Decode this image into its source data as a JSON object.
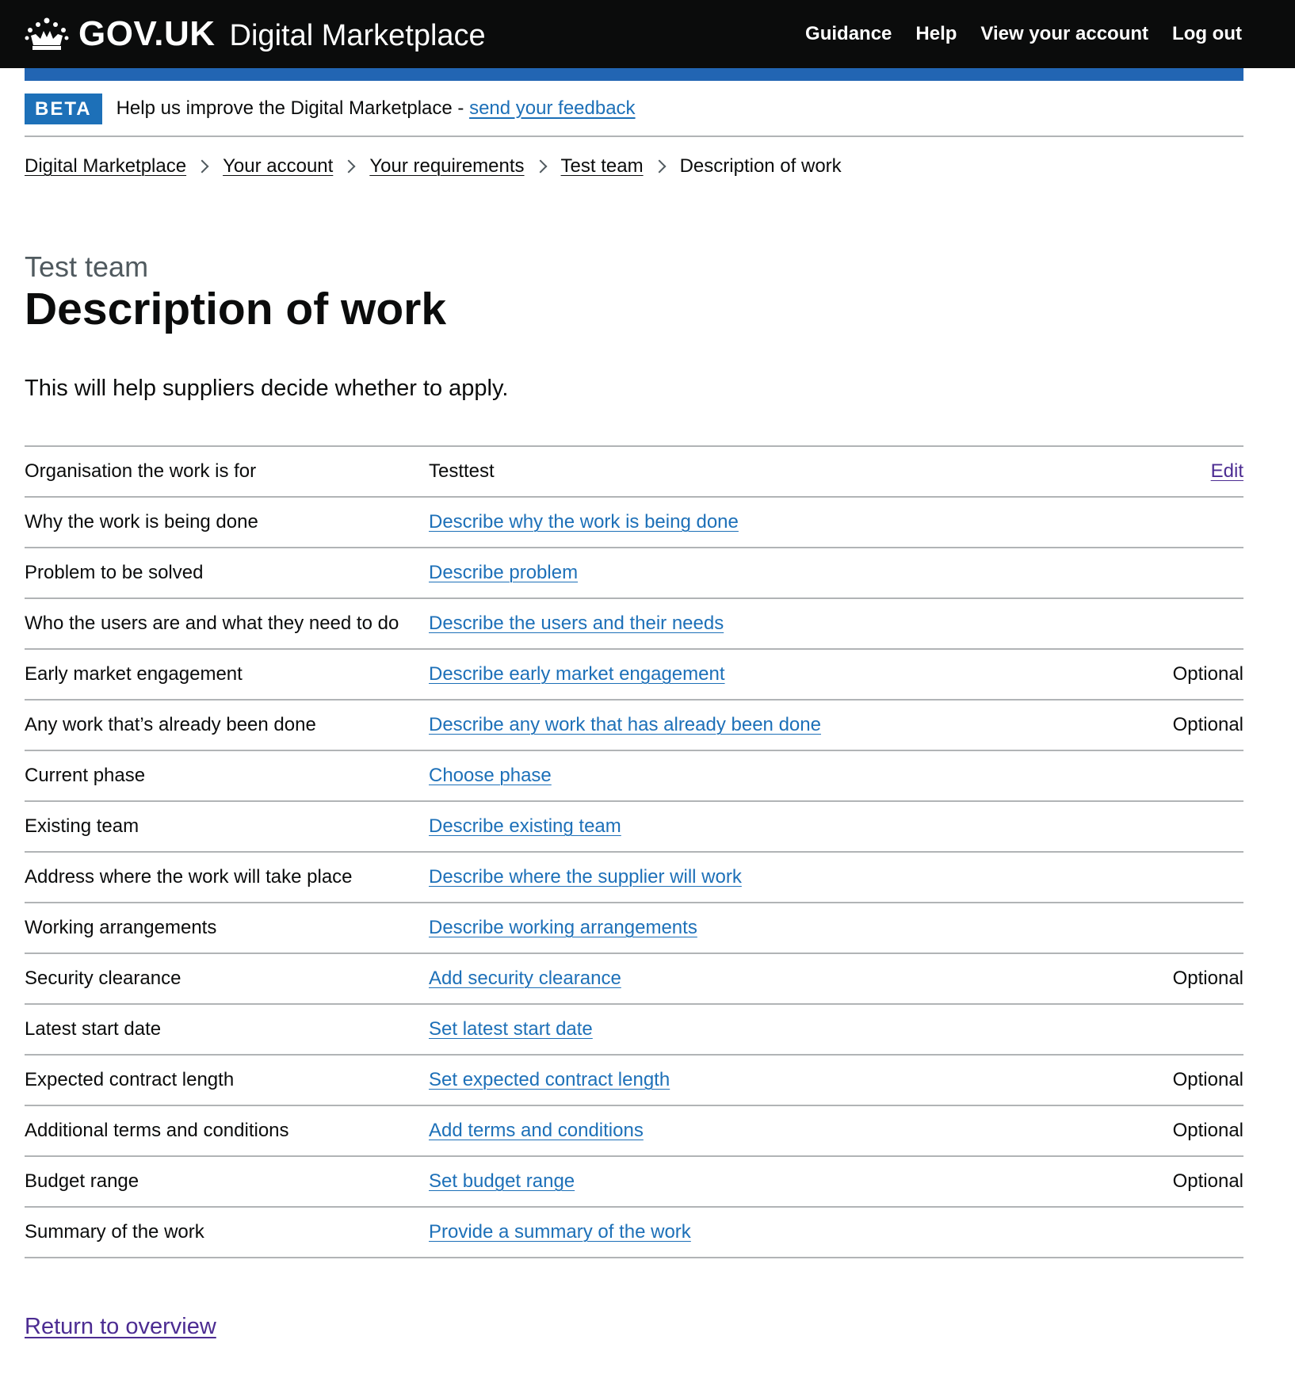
{
  "header": {
    "logotype": "GOV.UK",
    "service_name": "Digital Marketplace",
    "nav": [
      "Guidance",
      "Help",
      "View your account",
      "Log out"
    ],
    "colors": {
      "header_bg": "#0b0c0c",
      "blue_bar": "#2265b3"
    }
  },
  "beta": {
    "tag": "BETA",
    "text": "Help us improve the Digital Marketplace - ",
    "link": "send your feedback"
  },
  "breadcrumbs": {
    "links": [
      "Digital Marketplace",
      "Your account",
      "Your requirements",
      "Test team"
    ],
    "current": "Description of work"
  },
  "page": {
    "caption": "Test team",
    "title": "Description of work",
    "lede": "This will help suppliers decide whether to apply."
  },
  "summary": [
    {
      "key": "Organisation the work is for",
      "value": "Testtest",
      "action": "Edit"
    },
    {
      "key": "Why the work is being done",
      "link": "Describe why the work is being done",
      "action": ""
    },
    {
      "key": "Problem to be solved",
      "link": "Describe problem",
      "action": ""
    },
    {
      "key": "Who the users are and what they need to do",
      "link": "Describe the users and their needs",
      "action": ""
    },
    {
      "key": "Early market engagement",
      "link": "Describe early market engagement",
      "action": "Optional"
    },
    {
      "key": "Any work that’s already been done",
      "link": "Describe any work that has already been done",
      "action": "Optional"
    },
    {
      "key": "Current phase",
      "link": "Choose phase",
      "action": ""
    },
    {
      "key": "Existing team",
      "link": "Describe existing team",
      "action": ""
    },
    {
      "key": "Address where the work will take place",
      "link": "Describe where the supplier will work",
      "action": ""
    },
    {
      "key": "Working arrangements",
      "link": "Describe working arrangements",
      "action": ""
    },
    {
      "key": "Security clearance",
      "link": "Add security clearance",
      "action": "Optional"
    },
    {
      "key": "Latest start date",
      "link": "Set latest start date",
      "action": ""
    },
    {
      "key": "Expected contract length",
      "link": "Set expected contract length",
      "action": "Optional"
    },
    {
      "key": "Additional terms and conditions",
      "link": "Add terms and conditions",
      "action": "Optional"
    },
    {
      "key": "Budget range",
      "link": "Set budget range",
      "action": "Optional"
    },
    {
      "key": "Summary of the work",
      "link": "Provide a summary of the work",
      "action": ""
    }
  ],
  "footer": {
    "return_link": "Return to overview"
  },
  "icons": {
    "logo": "crown-icon",
    "breadcrumb_separator": "chevron-right-icon"
  }
}
